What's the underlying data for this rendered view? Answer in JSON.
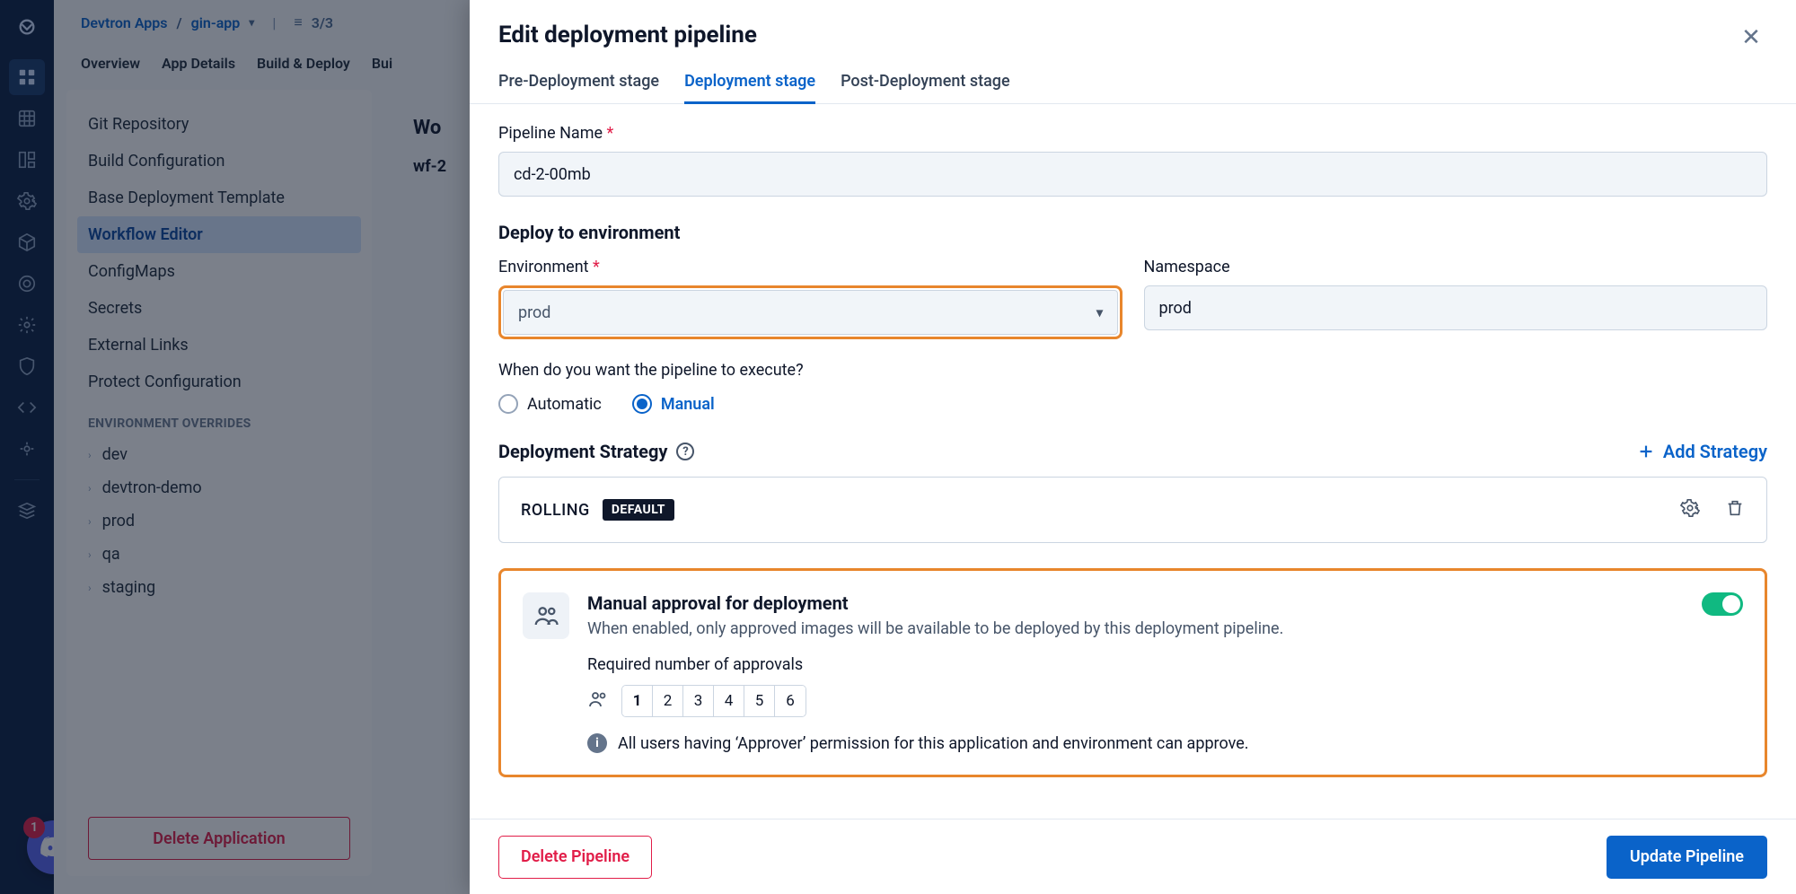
{
  "rail": {
    "discord_badge": "1"
  },
  "background": {
    "breadcrumb_root": "Devtron Apps",
    "breadcrumb_sep": "/",
    "breadcrumb_app": "gin-app",
    "filter_text": "3/3",
    "tabs": {
      "overview": "Overview",
      "details": "App Details",
      "build": "Build & Deploy",
      "bui": "Bui"
    },
    "side_items": {
      "git": "Git Repository",
      "build_conf": "Build Configuration",
      "base_tmpl": "Base Deployment Template",
      "workflow": "Workflow Editor",
      "configmaps": "ConfigMaps",
      "secrets": "Secrets",
      "ext_links": "External Links",
      "protect": "Protect Configuration"
    },
    "env_header": "ENVIRONMENT OVERRIDES",
    "envs": [
      "dev",
      "devtron-demo",
      "prod",
      "qa",
      "staging"
    ],
    "delete_app": "Delete Application",
    "main_wo": "Wo",
    "main_wf": "wf-2"
  },
  "modal": {
    "title": "Edit deployment pipeline",
    "tabs": {
      "pre": "Pre-Deployment stage",
      "dep": "Deployment stage",
      "post": "Post-Deployment stage"
    },
    "pipeline_name_label": "Pipeline Name",
    "pipeline_name_value": "cd-2-00mb",
    "deploy_section": "Deploy to environment",
    "env_label": "Environment",
    "env_value": "prod",
    "ns_label": "Namespace",
    "ns_value": "prod",
    "exec_question": "When do you want the pipeline to execute?",
    "exec_auto": "Automatic",
    "exec_manual": "Manual",
    "strategy_header": "Deployment Strategy",
    "add_strategy": "Add Strategy",
    "strategy_name": "ROLLING",
    "strategy_badge": "DEFAULT",
    "approval": {
      "title": "Manual approval for deployment",
      "desc": "When enabled, only approved images will be available to be deployed by this deployment pipeline.",
      "req_label": "Required number of approvals",
      "counts": [
        "1",
        "2",
        "3",
        "4",
        "5",
        "6"
      ],
      "selected_count": "1",
      "hint": "All users having ‘Approver’ permission for this application and environment can approve."
    },
    "delete_btn": "Delete Pipeline",
    "update_btn": "Update Pipeline"
  }
}
